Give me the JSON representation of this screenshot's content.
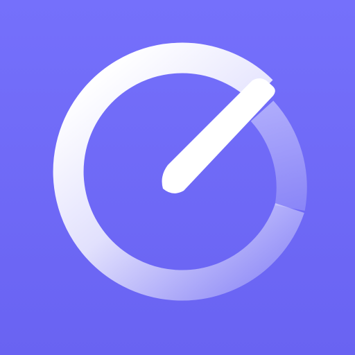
{
  "icon": {
    "name": "speedometer-icon",
    "colors": {
      "background_top": "#7570fb",
      "background_bottom": "#6963f2",
      "foreground": "#ffffff"
    }
  }
}
